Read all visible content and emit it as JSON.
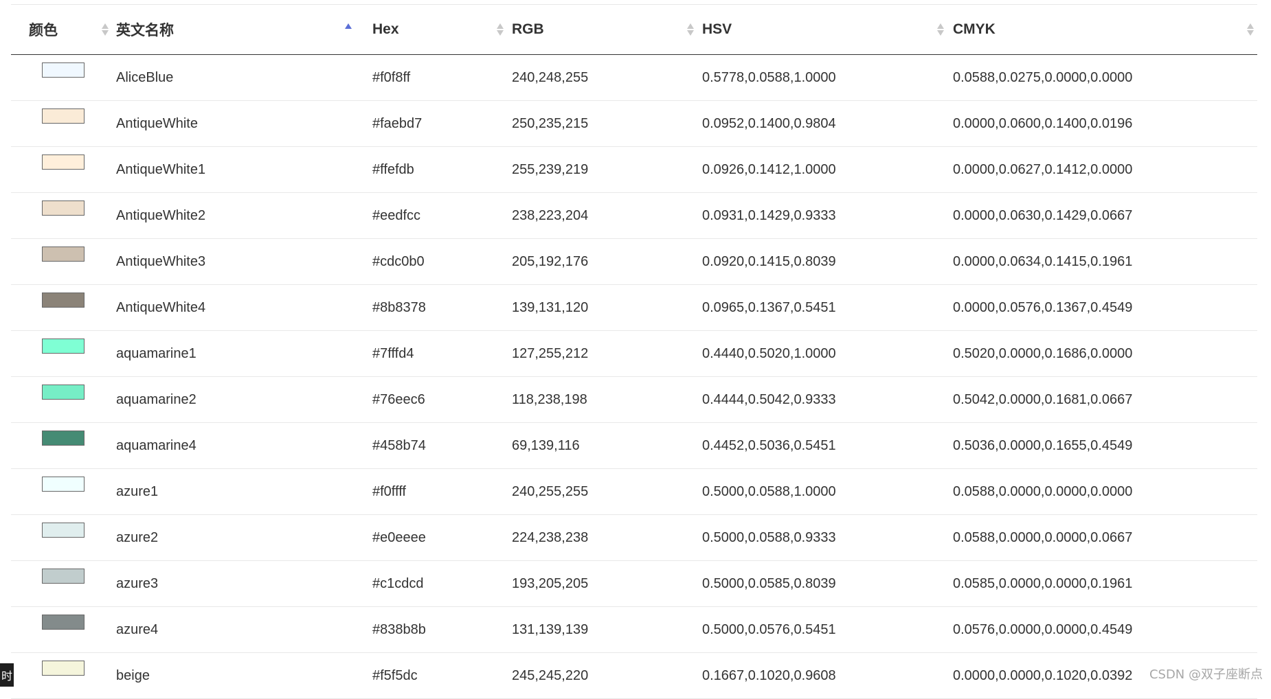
{
  "table": {
    "headers": [
      "颜色",
      "英文名称",
      "Hex",
      "RGB",
      "HSV",
      "CMYK"
    ],
    "sort": {
      "column": "英文名称",
      "direction": "ascending"
    },
    "rows": [
      {
        "color": "#f0f8ff",
        "name": "AliceBlue",
        "hex": "#f0f8ff",
        "rgb": "240,248,255",
        "hsv": "0.5778,0.0588,1.0000",
        "cmyk": "0.0588,0.0275,0.0000,0.0000"
      },
      {
        "color": "#faebd7",
        "name": "AntiqueWhite",
        "hex": "#faebd7",
        "rgb": "250,235,215",
        "hsv": "0.0952,0.1400,0.9804",
        "cmyk": "0.0000,0.0600,0.1400,0.0196"
      },
      {
        "color": "#ffefdb",
        "name": "AntiqueWhite1",
        "hex": "#ffefdb",
        "rgb": "255,239,219",
        "hsv": "0.0926,0.1412,1.0000",
        "cmyk": "0.0000,0.0627,0.1412,0.0000"
      },
      {
        "color": "#eedfcc",
        "name": "AntiqueWhite2",
        "hex": "#eedfcc",
        "rgb": "238,223,204",
        "hsv": "0.0931,0.1429,0.9333",
        "cmyk": "0.0000,0.0630,0.1429,0.0667"
      },
      {
        "color": "#cdc0b0",
        "name": "AntiqueWhite3",
        "hex": "#cdc0b0",
        "rgb": "205,192,176",
        "hsv": "0.0920,0.1415,0.8039",
        "cmyk": "0.0000,0.0634,0.1415,0.1961"
      },
      {
        "color": "#8b8378",
        "name": "AntiqueWhite4",
        "hex": "#8b8378",
        "rgb": "139,131,120",
        "hsv": "0.0965,0.1367,0.5451",
        "cmyk": "0.0000,0.0576,0.1367,0.4549"
      },
      {
        "color": "#7fffd4",
        "name": "aquamarine1",
        "hex": "#7fffd4",
        "rgb": "127,255,212",
        "hsv": "0.4440,0.5020,1.0000",
        "cmyk": "0.5020,0.0000,0.1686,0.0000"
      },
      {
        "color": "#76eec6",
        "name": "aquamarine2",
        "hex": "#76eec6",
        "rgb": "118,238,198",
        "hsv": "0.4444,0.5042,0.9333",
        "cmyk": "0.5042,0.0000,0.1681,0.0667"
      },
      {
        "color": "#458b74",
        "name": "aquamarine4",
        "hex": "#458b74",
        "rgb": "69,139,116",
        "hsv": "0.4452,0.5036,0.5451",
        "cmyk": "0.5036,0.0000,0.1655,0.4549"
      },
      {
        "color": "#f0ffff",
        "name": "azure1",
        "hex": "#f0ffff",
        "rgb": "240,255,255",
        "hsv": "0.5000,0.0588,1.0000",
        "cmyk": "0.0588,0.0000,0.0000,0.0000"
      },
      {
        "color": "#e0eeee",
        "name": "azure2",
        "hex": "#e0eeee",
        "rgb": "224,238,238",
        "hsv": "0.5000,0.0588,0.9333",
        "cmyk": "0.0588,0.0000,0.0000,0.0667"
      },
      {
        "color": "#c1cdcd",
        "name": "azure3",
        "hex": "#c1cdcd",
        "rgb": "193,205,205",
        "hsv": "0.5000,0.0585,0.8039",
        "cmyk": "0.0585,0.0000,0.0000,0.1961"
      },
      {
        "color": "#838b8b",
        "name": "azure4",
        "hex": "#838b8b",
        "rgb": "131,139,139",
        "hsv": "0.5000,0.0576,0.5451",
        "cmyk": "0.0576,0.0000,0.0000,0.4549"
      },
      {
        "color": "#f5f5dc",
        "name": "beige",
        "hex": "#f5f5dc",
        "rgb": "245,245,220",
        "hsv": "0.1667,0.1020,0.9608",
        "cmyk": "0.0000,0.0000,0.1020,0.0392"
      }
    ]
  },
  "corner_tag": "时",
  "watermark": "CSDN @双子座断点",
  "colors": {
    "sort_active": "#5b6fd6",
    "sort_inactive": "#c8c8c8",
    "row_border": "#e8e8e8",
    "header_border": "#333333"
  }
}
